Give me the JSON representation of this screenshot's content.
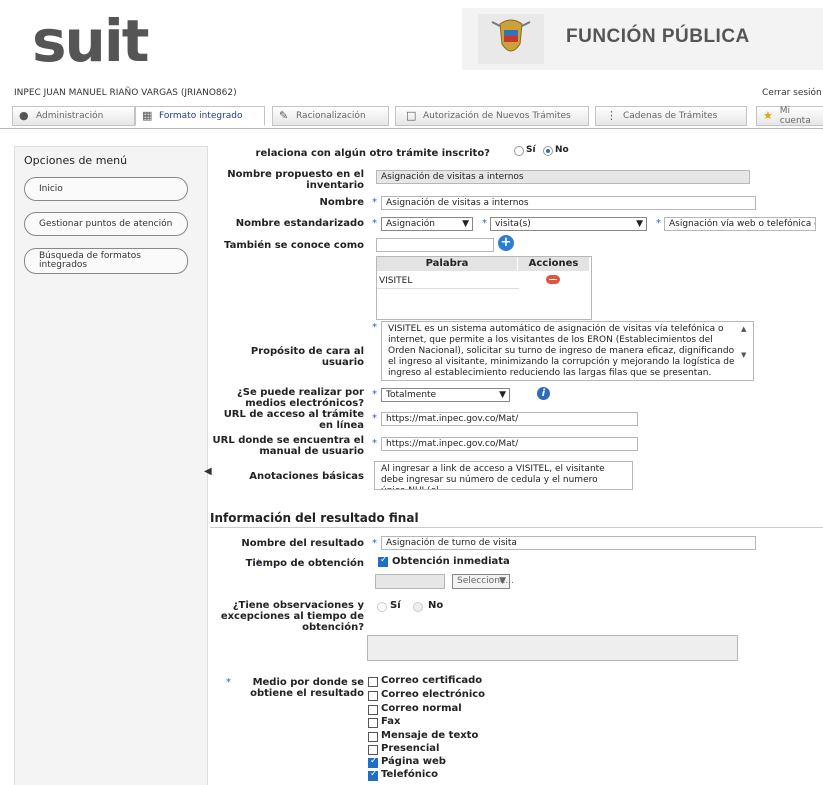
{
  "header": {
    "logo": "suit",
    "org_title": "FUNCIÓN PÚBLICA",
    "user": "INPEC JUAN MANUEL RIAÑO VARGAS (JRIANO862)",
    "logout": "Cerrar sesión"
  },
  "tabs": [
    {
      "label": "Administración",
      "icon": "users-icon"
    },
    {
      "label": "Formato integrado",
      "icon": "form-icon"
    },
    {
      "label": "Racionalización",
      "icon": "edit-icon"
    },
    {
      "label": "Autorización de Nuevos Trámites",
      "icon": "document-icon"
    },
    {
      "label": "Cadenas de Trámites",
      "icon": "chain-icon"
    },
    {
      "label": "Mi cuenta",
      "icon": "star-icon"
    }
  ],
  "sidebar": {
    "title": "Opciones de menú",
    "items": [
      "Inicio",
      "Gestionar puntos de atención",
      "Búsqueda de formatos integrados"
    ]
  },
  "form": {
    "related_label": "relaciona con algún otro trámite inscrito?",
    "related_options": [
      "Sí",
      "No"
    ],
    "related_selected": "No",
    "proposed_name_label": "Nombre propuesto en el inventario",
    "proposed_name_value": "Asignación de visitas a internos",
    "name_label": "Nombre",
    "name_value": "Asignación de visitas a internos",
    "std_name_label": "Nombre estandarizado",
    "std_name_sel1": "Asignación",
    "std_name_sel2": "visita(s)",
    "std_name_text": "Asignación vía web o telefónica de",
    "aka_label": "También se conoce como",
    "aka_value": "",
    "aka_table": {
      "headers": [
        "Palabra",
        "Acciones"
      ],
      "rows": [
        {
          "word": "VISITEL"
        }
      ]
    },
    "purpose_label": "Propósito de cara al usuario",
    "purpose_value": "VISITEL es un sistema automático de asignación de visitas vía telefónica o internet, que permite a los visitantes de los ERON (Establecimientos del Orden Nacional), solicitar su turno de ingreso de manera eficaz, dignificando el ingreso al visitante, minimizando la corrupción y mejorando la logística de ingreso al establecimiento reduciendo las largas filas que se presentan.",
    "electronic_label": "¿Se puede realizar por medios electrónicos?",
    "electronic_value": "Totalmente",
    "url_access_label": "URL de acceso al trámite en línea",
    "url_access_value": "https://mat.inpec.gov.co/Mat/",
    "url_manual_label": "URL donde se encuentra el manual de usuario",
    "url_manual_value": "https://mat.inpec.gov.co/Mat/",
    "notes_label": "Anotaciones básicas",
    "notes_value": "Al ingresar a link de acceso a VISITEL, el visitante debe ingresar su número de cedula y el numero único NUI (el"
  },
  "result": {
    "section_title": "Información del resultado final",
    "result_name_label": "Nombre del resultado",
    "result_name_value": "Asignación de turno de visita",
    "time_label": "Tiempo de obtención",
    "immediate_label": "Obtención inmediata",
    "immediate_checked": true,
    "time_select": "Seleccione...",
    "obs_label": "¿Tiene observaciones y excepciones al tiempo de obtención?",
    "obs_options": [
      "Sí",
      "No"
    ],
    "obs_selected": "No",
    "medium_label": "Medio por donde se obtiene el resultado",
    "mediums": [
      {
        "label": "Correo certificado",
        "checked": false
      },
      {
        "label": "Correo electrónico",
        "checked": false
      },
      {
        "label": "Correo normal",
        "checked": false
      },
      {
        "label": "Fax",
        "checked": false
      },
      {
        "label": "Mensaje de texto",
        "checked": false
      },
      {
        "label": "Presencial",
        "checked": false
      },
      {
        "label": "Página web",
        "checked": true
      },
      {
        "label": "Telefónico",
        "checked": true
      }
    ]
  },
  "colors": {
    "accent": "#2d6db8",
    "tab_active": "#1a3f8f",
    "delete": "#e0553b"
  }
}
